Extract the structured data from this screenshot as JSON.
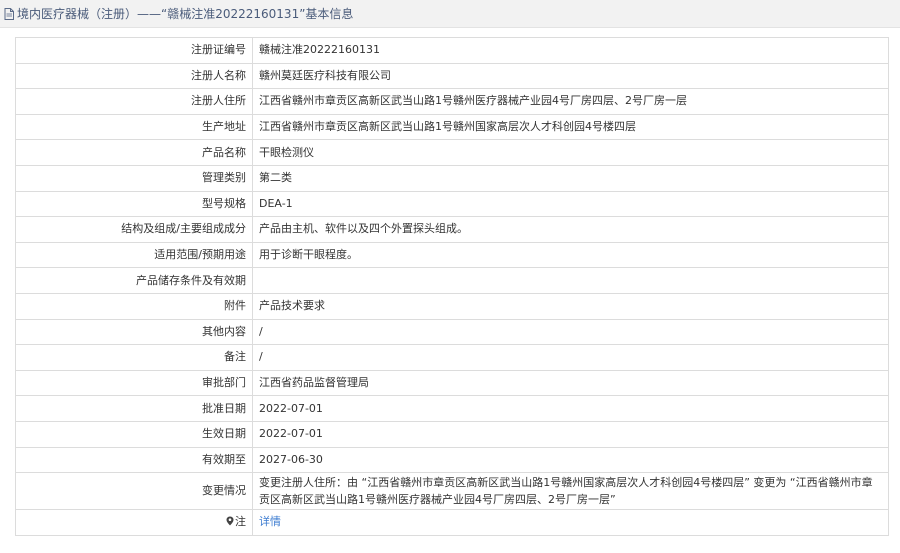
{
  "header": {
    "icon": "document-icon",
    "title": "境内医疗器械（注册）——“赣械注准20222160131”基本信息"
  },
  "rows": [
    {
      "label": "注册证编号",
      "value": "赣械注准20222160131"
    },
    {
      "label": "注册人名称",
      "value": "赣州莫廷医疗科技有限公司"
    },
    {
      "label": "注册人住所",
      "value": "江西省赣州市章贡区高新区武当山路1号赣州医疗器械产业园4号厂房四层、2号厂房一层"
    },
    {
      "label": "生产地址",
      "value": "江西省赣州市章贡区高新区武当山路1号赣州国家高层次人才科创园4号楼四层"
    },
    {
      "label": "产品名称",
      "value": "干眼检测仪"
    },
    {
      "label": "管理类别",
      "value": "第二类"
    },
    {
      "label": "型号规格",
      "value": "DEA-1"
    },
    {
      "label": "结构及组成/主要组成成分",
      "value": "产品由主机、软件以及四个外置探头组成。"
    },
    {
      "label": "适用范围/预期用途",
      "value": "用于诊断干眼程度。"
    },
    {
      "label": "产品储存条件及有效期",
      "value": ""
    },
    {
      "label": "附件",
      "value": "产品技术要求"
    },
    {
      "label": "其他内容",
      "value": "/"
    },
    {
      "label": "备注",
      "value": "/"
    },
    {
      "label": "审批部门",
      "value": "江西省药品监督管理局"
    },
    {
      "label": "批准日期",
      "value": "2022-07-01"
    },
    {
      "label": "生效日期",
      "value": "2022-07-01"
    },
    {
      "label": "有效期至",
      "value": "2027-06-30"
    },
    {
      "label": "变更情况",
      "value": "变更注册人住所：由 “江西省赣州市章贡区高新区武当山路1号赣州国家高层次人才科创园4号楼四层” 变更为 “江西省赣州市章贡区高新区武当山路1号赣州医疗器械产业园4号厂房四层、2号厂房一层”"
    }
  ],
  "note_row": {
    "label": "注",
    "label_icon": "map-pin-icon",
    "link_text": "详情"
  },
  "colors": {
    "header_bg": "#f2f2f2",
    "header_text": "#4a5b7a",
    "border": "#dcdcdc",
    "link": "#3b7bd0"
  }
}
